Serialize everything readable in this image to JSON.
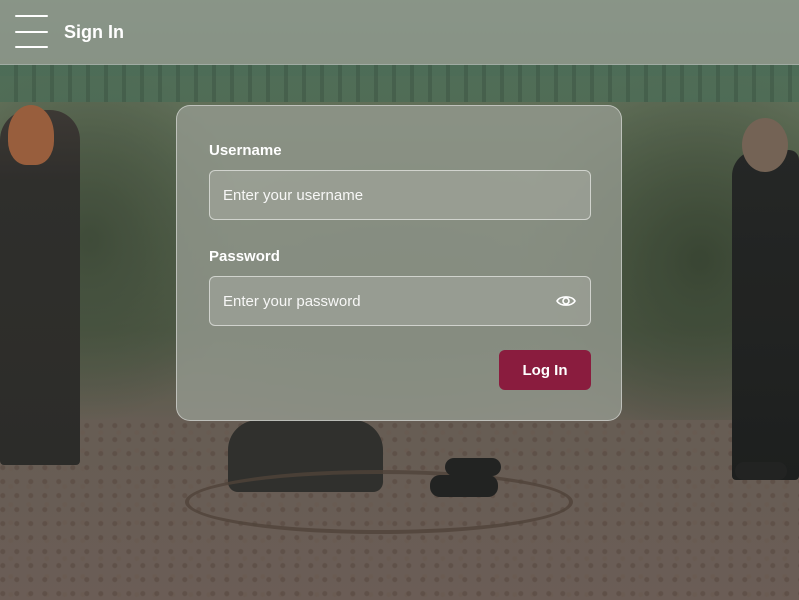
{
  "header": {
    "menu_icon": "hamburger-menu-icon",
    "title": "Sign In"
  },
  "login_form": {
    "username_label": "Username",
    "username_placeholder": "Enter your username",
    "username_value": "",
    "password_label": "Password",
    "password_placeholder": "Enter your password",
    "password_value": "",
    "show_password_icon": "eye-icon",
    "submit_label": "Log In"
  },
  "colors": {
    "accent": "#8a1c3e"
  }
}
